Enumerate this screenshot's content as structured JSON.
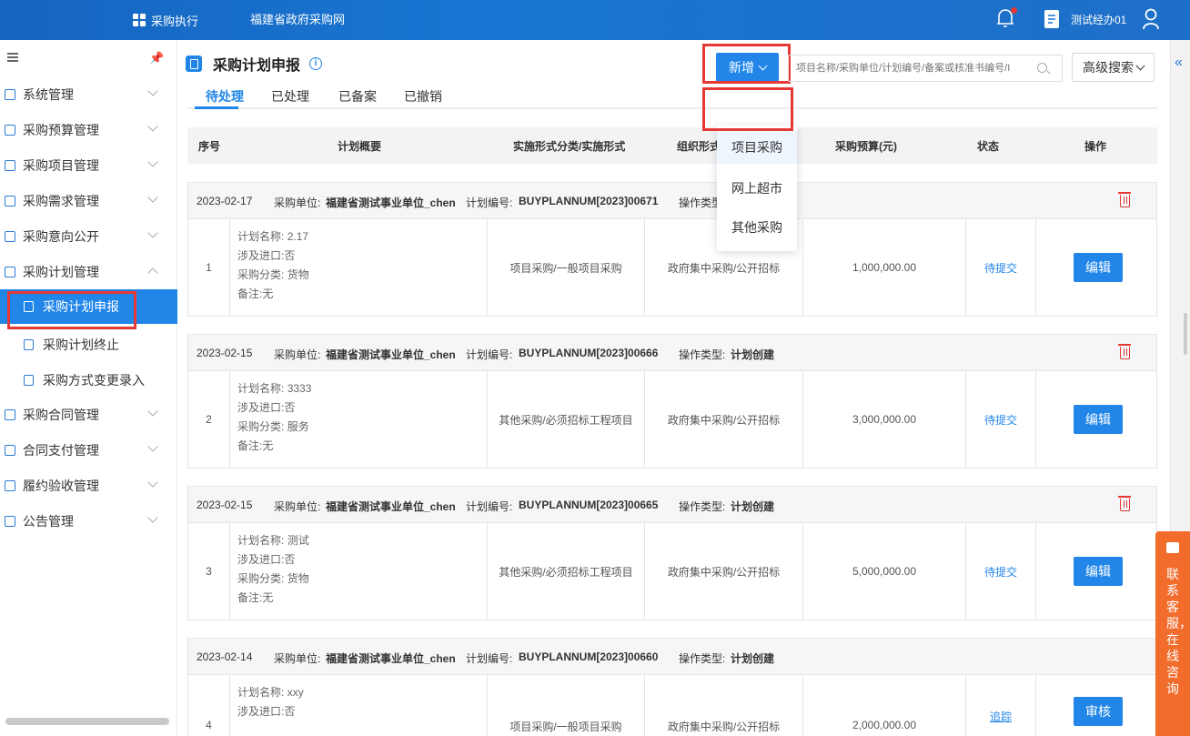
{
  "topbar": {
    "module_label": "采购执行",
    "site_name": "福建省政府采购网",
    "user_name": "测试经办01"
  },
  "sidebar": {
    "items": [
      {
        "label": "系统管理"
      },
      {
        "label": "采购预算管理"
      },
      {
        "label": "采购项目管理"
      },
      {
        "label": "采购需求管理"
      },
      {
        "label": "采购意向公开"
      },
      {
        "label": "采购计划管理"
      },
      {
        "label": "采购合同管理"
      },
      {
        "label": "合同支付管理"
      },
      {
        "label": "履约验收管理"
      },
      {
        "label": "公告管理"
      }
    ],
    "sub_items": [
      {
        "label": "采购计划申报"
      },
      {
        "label": "采购计划终止"
      },
      {
        "label": "采购方式变更录入"
      }
    ]
  },
  "page": {
    "title": "采购计划申报",
    "new_button": "新增",
    "search_placeholder": "项目名称/采购单位/计划编号/备案或核准书编号/I",
    "advanced_search": "高级搜索",
    "tabs": [
      {
        "label": "待处理"
      },
      {
        "label": "已处理"
      },
      {
        "label": "已备案"
      },
      {
        "label": "已撤销"
      }
    ]
  },
  "dropdown": {
    "options": [
      "项目采购",
      "网上超市",
      "其他采购"
    ]
  },
  "table": {
    "headers": [
      "序号",
      "计划概要",
      "实施形式分类/实施形式",
      "组织形式",
      "采购预算(元)",
      "状态",
      "操作"
    ],
    "meta_labels": {
      "unit": "采购单位:",
      "plan_no": "计划编号:",
      "op_type": "操作类型:"
    },
    "summary_labels": {
      "name": "计划名称:",
      "import": "涉及进口:",
      "category": "采购分类:",
      "remark": "备注:"
    },
    "rows": [
      {
        "date": "2023-02-17",
        "unit": "福建省测试事业单位_chen",
        "plan_no": "BUYPLANNUM[2023]00671",
        "op_type": "",
        "index": "1",
        "name": "2.17",
        "import": "否",
        "category": "货物",
        "remark": "无",
        "form": "项目采购/一般项目采购",
        "org": "政府集中采购/公开招标",
        "budget": "1,000,000.00",
        "status": "待提交",
        "action": "编辑"
      },
      {
        "date": "2023-02-15",
        "unit": "福建省测试事业单位_chen",
        "plan_no": "BUYPLANNUM[2023]00666",
        "op_type": "计划创建",
        "index": "2",
        "name": "3333",
        "import": "否",
        "category": "服务",
        "remark": "无",
        "form": "其他采购/必须招标工程项目",
        "org": "政府集中采购/公开招标",
        "budget": "3,000,000.00",
        "status": "待提交",
        "action": "编辑"
      },
      {
        "date": "2023-02-15",
        "unit": "福建省测试事业单位_chen",
        "plan_no": "BUYPLANNUM[2023]00665",
        "op_type": "计划创建",
        "index": "3",
        "name": "测试",
        "import": "否",
        "category": "货物",
        "remark": "无",
        "form": "其他采购/必须招标工程项目",
        "org": "政府集中采购/公开招标",
        "budget": "5,000,000.00",
        "status": "待提交",
        "action": "编辑"
      },
      {
        "date": "2023-02-14",
        "unit": "福建省测试事业单位_chen",
        "plan_no": "BUYPLANNUM[2023]00660",
        "op_type": "计划创建",
        "index": "4",
        "name": "xxy",
        "import": "否",
        "category": "",
        "remark": "",
        "form": "项目采购/一般项目采购",
        "org": "政府集中采购/公开招标",
        "budget": "2,000,000.00",
        "status": "追踪",
        "action": "审核"
      }
    ]
  },
  "contact": {
    "label": "联系客服，在线咨询"
  },
  "colors": {
    "primary": "#2186e8",
    "highlight": "#e53935",
    "contact": "#f26c2c"
  }
}
